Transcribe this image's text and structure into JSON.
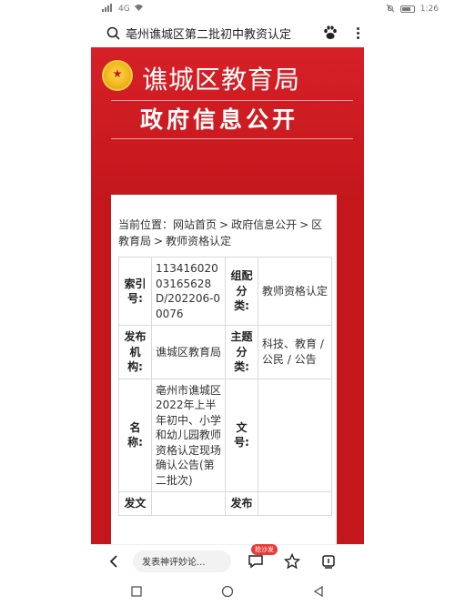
{
  "status_bar": {
    "carrier": "4G",
    "time": "1:26"
  },
  "browser": {
    "query": "亳州谯城区第二批初中教资认定",
    "icons": [
      "search-icon",
      "paw-icon",
      "more-icon"
    ]
  },
  "banner": {
    "org_name": "谯城区教育局",
    "section_title": "政府信息公开"
  },
  "breadcrumb": {
    "prefix": "当前位置：",
    "items": [
      "网站首页",
      "政府信息公开",
      "区教育局",
      "教师资格认定"
    ],
    "separator": ">"
  },
  "meta_table": {
    "rows": [
      {
        "label1": "索引号:",
        "value1": "11341602003165628D/202206-00076",
        "label2": "组配分类:",
        "value2": "教师资格认定"
      },
      {
        "label1": "发布机构:",
        "value1": "谯城区教育局",
        "label2": "主题分类:",
        "value2": "科技、教育 / 公民 / 公告"
      },
      {
        "label1": "名称:",
        "value1": "亳州市谯城区2022年上半年初中、小学和幼儿园教师资格认定现场确认公告(第二批次)",
        "label2": "文号:",
        "value2": ""
      },
      {
        "label1": "发文",
        "value1": "",
        "label2": "发布",
        "value2": ""
      }
    ]
  },
  "toolbar": {
    "comment_placeholder": "发表神评妙论...",
    "badge": "抢沙发",
    "icons": [
      "back-icon",
      "comment-icon",
      "star-icon",
      "share-icon"
    ]
  },
  "colors": {
    "banner_red": "#c3171c",
    "badge_red": "#e83a3a"
  }
}
